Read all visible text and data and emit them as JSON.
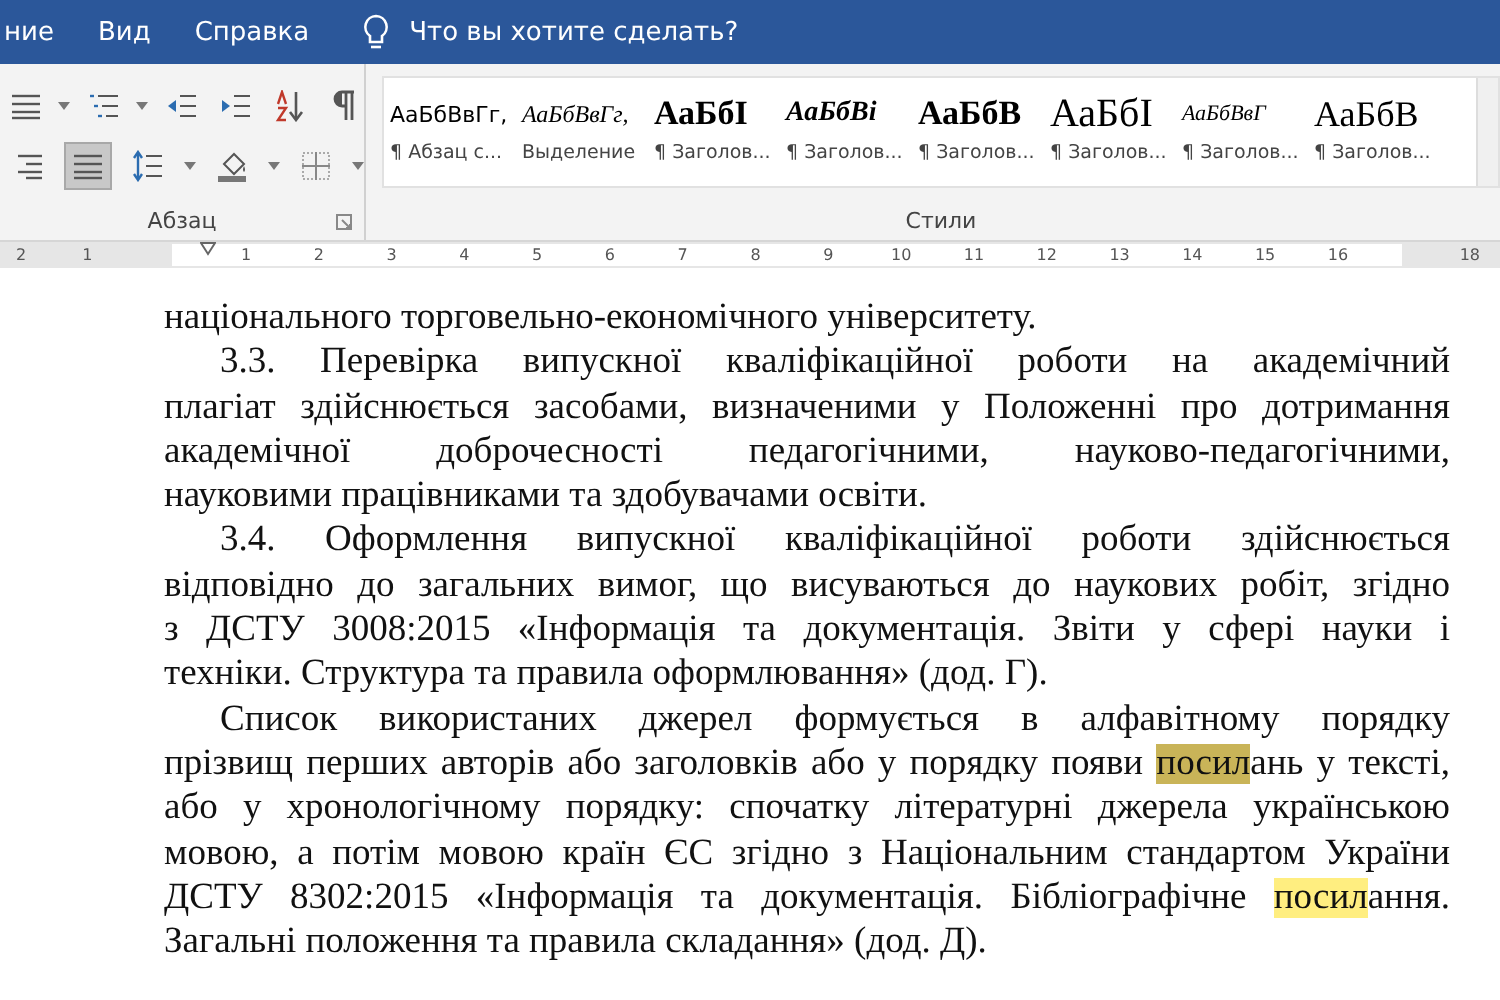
{
  "menu": {
    "items": [
      "ние",
      "Вид",
      "Справка"
    ],
    "tell_me": "Что вы хотите сделать?"
  },
  "ribbon": {
    "paragraph_group": {
      "label": "Абзац",
      "align_buttons": [
        {
          "kind": "align-right",
          "selected": false
        },
        {
          "kind": "justify",
          "selected": true
        }
      ]
    },
    "styles_group": {
      "label": "Стили",
      "styles": [
        {
          "preview": "АаБбВвГг,",
          "name": "¶ Абзац с...",
          "kind": "normal"
        },
        {
          "preview": "АаБбВвГг,",
          "name": "Выделение",
          "kind": "italic"
        },
        {
          "preview": "АаБбІ",
          "name": "¶ Заголов...",
          "kind": "heading"
        },
        {
          "preview": "АаБбВі",
          "name": "¶ Заголов...",
          "kind": "heading-italic"
        },
        {
          "preview": "АаБбВ",
          "name": "¶ Заголов...",
          "kind": "heading"
        },
        {
          "preview": "АаБбІ",
          "name": "¶ Заголов...",
          "kind": "title"
        },
        {
          "preview": "АаБбВвГ",
          "name": "¶ Заголов...",
          "kind": "small-italic"
        },
        {
          "preview": "АаБбВ",
          "name": "¶ Заголов...",
          "kind": "plain-large"
        }
      ]
    }
  },
  "ruler": {
    "left_marks": [
      "2",
      "1"
    ],
    "marks": [
      "1",
      "2",
      "3",
      "4",
      "5",
      "6",
      "7",
      "8",
      "9",
      "10",
      "11",
      "12",
      "13",
      "14",
      "15",
      "16"
    ],
    "right_marks": [
      "18"
    ]
  },
  "document": {
    "paragraphs": [
      {
        "first_line_indent": false,
        "lines": [
          {
            "text": "національного торговельно-економічного університету."
          }
        ]
      },
      {
        "first_line_indent": true,
        "lines": [
          {
            "text": "3.3. Перевірка випускної кваліфікаційної роботи    на академічний"
          },
          {
            "text": "плагіат здійснюється засобами, визначеними у Положенні про дотримання"
          },
          {
            "text": "академічної доброчесності педагогічними, науково-педагогічними,"
          },
          {
            "text": "науковими працівниками та здобувачами освіти."
          }
        ]
      },
      {
        "first_line_indent": true,
        "lines": [
          {
            "text": "3.4. Оформлення випускної кваліфікаційної роботи  здійснюється"
          },
          {
            "text": "відповідно до загальних вимог, що висуваються до наукових робіт, згідно"
          },
          {
            "text": "з ДСТУ 3008:2015 «Інформація та документація. Звіти у сфері науки і"
          },
          {
            "text": "техніки. Структура та правила оформлювання» (дод. Г)."
          }
        ]
      },
      {
        "first_line_indent": true,
        "lines": [
          {
            "text": "Список використаних джерел формується в алфавітному порядку"
          },
          {
            "segments": [
              {
                "text": "прізвищ перших авторів або заголовків або у порядку появи ",
                "highlighted": false,
                "current": false
              },
              {
                "text": "посил",
                "highlighted": true,
                "current": true
              },
              {
                "text": "ань у тексті,",
                "highlighted": false,
                "current": false
              }
            ]
          },
          {
            "text": "або у хронологічному порядку: спочатку літературні джерела українською"
          },
          {
            "text": "мовою, а потім мовою країн ЄС згідно з Національним стандартом України"
          },
          {
            "segments": [
              {
                "text": "ДСТУ 8302:2015 «Інформація та документація. Бібліографічне ",
                "highlighted": false,
                "current": false
              },
              {
                "text": "посил",
                "highlighted": true,
                "current": false
              },
              {
                "text": "ання.",
                "highlighted": false,
                "current": false
              }
            ]
          },
          {
            "text": "Загальні  положення та правила складання» (дод. Д)."
          }
        ]
      }
    ]
  }
}
